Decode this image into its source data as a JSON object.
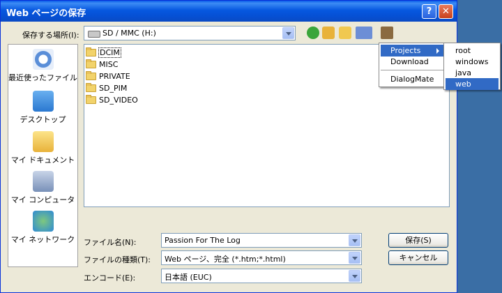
{
  "window": {
    "title": "Web ページの保存"
  },
  "location": {
    "label": "保存する場所(I):",
    "value": "SD / MMC (H:)"
  },
  "places": [
    {
      "label": "最近使ったファイル"
    },
    {
      "label": "デスクトップ"
    },
    {
      "label": "マイ ドキュメント"
    },
    {
      "label": "マイ コンピュータ"
    },
    {
      "label": "マイ ネットワーク"
    }
  ],
  "files": [
    "DCIM",
    "MISC",
    "PRIVATE",
    "SD_PIM",
    "SD_VIDEO"
  ],
  "form": {
    "filename_label": "ファイル名(N):",
    "filename_value": "Passion For The Log",
    "filetype_label": "ファイルの種類(T):",
    "filetype_value": "Web ページ、完全 (*.htm;*.html)",
    "encoding_label": "エンコード(E):",
    "encoding_value": "日本語 (EUC)"
  },
  "buttons": {
    "save": "保存(S)",
    "cancel": "キャンセル"
  },
  "menu": {
    "items": [
      "Projects",
      "Download",
      "DialogMate"
    ],
    "submenu": [
      "root",
      "windows",
      "java",
      "web"
    ]
  },
  "colors": {
    "titlebar": "#0a5ce8",
    "highlight": "#316ac5",
    "window_bg": "#ece9d8",
    "desktop": "#3a6ea5"
  }
}
